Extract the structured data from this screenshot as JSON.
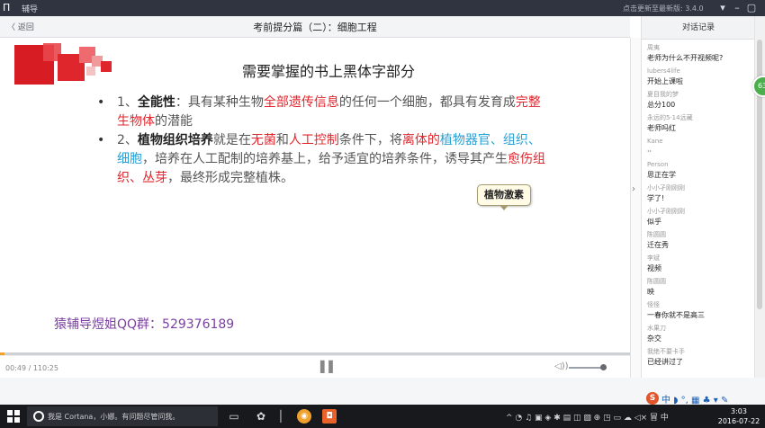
{
  "app": {
    "logo": "Π",
    "name": "辅导",
    "update_text": "点击更新至最新版: 3.4.0",
    "window_controls": [
      "▾",
      "–",
      "▢"
    ]
  },
  "lesson": {
    "back_label": "〈 返回",
    "title": "考前提分篇（二）：细胞工程"
  },
  "slide": {
    "heading": "需要掌握的书上黑体字部分",
    "item1": {
      "num": "1、",
      "term": "全能性",
      "t1": "：具有某种生物",
      "r1": "全部遗传信息",
      "t2": "的任何一个细胞，都具有发育成",
      "r2": "完整生物体",
      "t3": "的潜能"
    },
    "item2": {
      "num": "2、",
      "term": "植物组织培养",
      "t1": "就是在",
      "r1": "无菌",
      "t2": "和",
      "r2": "人工控制",
      "t3": "条件下，将",
      "r3": "离体的",
      "b1": "植物器官、组织、细胞",
      "t4": "，培养在人工配制的培养基上，给予适宜的培养条件，诱导其产生",
      "r4": "愈伤组织、丛芽",
      "t5": "，最终形成完整植株。"
    },
    "tooltip": "植物激素",
    "qq_text": "猿辅导煜姐QQ群：529376189"
  },
  "player": {
    "time": "00:49 / 110:25",
    "progress_fraction": 0.0074,
    "pause_icon": "pause-icon",
    "volume_fraction": 0.9
  },
  "chat": {
    "header": "对话记录",
    "badge": "63",
    "messages": [
      {
        "name": "周夷",
        "text": "老师为什么不开视频呢?"
      },
      {
        "name": "lubers4life",
        "text": "开始上课啦"
      },
      {
        "name": "夏目我的梦",
        "text": "总分100"
      },
      {
        "name": "永远的5·14远藏",
        "text": "老师吗红"
      },
      {
        "name": "Kane",
        "text": "··"
      },
      {
        "name": "Person",
        "text": "思正在学"
      },
      {
        "name": "小小孑刚刚刚",
        "text": "学了!"
      },
      {
        "name": "小小孑刚刚刚",
        "text": "似乎"
      },
      {
        "name": "陈圆圆",
        "text": "迁在秀"
      },
      {
        "name": "李斌",
        "text": "视频"
      },
      {
        "name": "陈圆圆",
        "text": "映"
      },
      {
        "name": "怪怪",
        "text": "一春你就不是高三"
      },
      {
        "name": "水果刀",
        "text": "杂交"
      },
      {
        "name": "我绝不要卡手",
        "text": "已经讲过了"
      }
    ]
  },
  "taskbar": {
    "cortana_placeholder": "我是 Cortana，小娜。有问题尽管问我。",
    "ime": "中 ◗ °, ▦ ♣ ▾ ✎",
    "tray": "^ ◔ ♫ ▣ ◈ ✱ ▤ ◫ ▧ ⊕ ◳ ▭ ☁ ◁× 冒 中",
    "time": "3:03",
    "date": "2016-07-22"
  },
  "colors": {
    "accent_red": "#e1262d",
    "accent_blue": "#2aa0d6",
    "qq_purple": "#7b3fa1",
    "progress_orange": "#f0a12c"
  }
}
